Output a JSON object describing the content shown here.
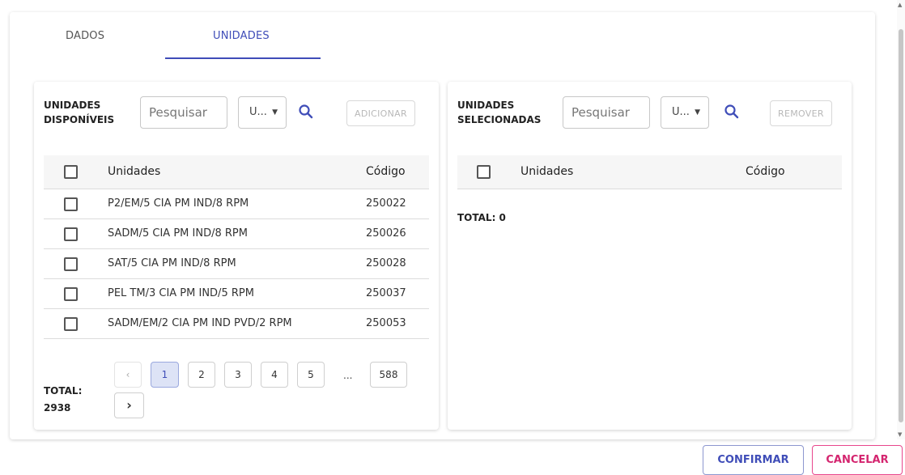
{
  "tabs": [
    {
      "label": "DADOS",
      "active": false
    },
    {
      "label": "UNIDADES",
      "active": true
    }
  ],
  "accent_color": "#3f4db8",
  "left_panel": {
    "title": "UNIDADES DISPONÍVEIS",
    "search_placeholder": "Pesquisar",
    "filter_value": "U...",
    "add_label": "ADICIONAR",
    "columns": [
      "Unidades",
      "Código"
    ],
    "rows": [
      {
        "name": "P2/EM/5 CIA PM IND/8 RPM",
        "code": "250022"
      },
      {
        "name": "SADM/5 CIA PM IND/8 RPM",
        "code": "250026"
      },
      {
        "name": "SAT/5 CIA PM IND/8 RPM",
        "code": "250028"
      },
      {
        "name": "PEL TM/3 CIA PM IND/5 RPM",
        "code": "250037"
      },
      {
        "name": "SADM/EM/2 CIA PM IND PVD/2 RPM",
        "code": "250053"
      }
    ],
    "total_label": "TOTAL:",
    "total_value": "2938",
    "pagination": {
      "prev": "‹",
      "pages": [
        "1",
        "2",
        "3",
        "4",
        "5"
      ],
      "current": "1",
      "ellipsis": "...",
      "last": "588",
      "next": "›"
    }
  },
  "right_panel": {
    "title": "UNIDADES SELECIONADAS",
    "search_placeholder": "Pesquisar",
    "filter_value": "U...",
    "remove_label": "REMOVER",
    "columns": [
      "Unidades",
      "Código"
    ],
    "total_text": "TOTAL: 0"
  },
  "footer": {
    "confirm_label": "CONFIRMAR",
    "cancel_label": "CANCELAR",
    "confirm_color": "#3f4db8",
    "cancel_color": "#d4256f"
  }
}
